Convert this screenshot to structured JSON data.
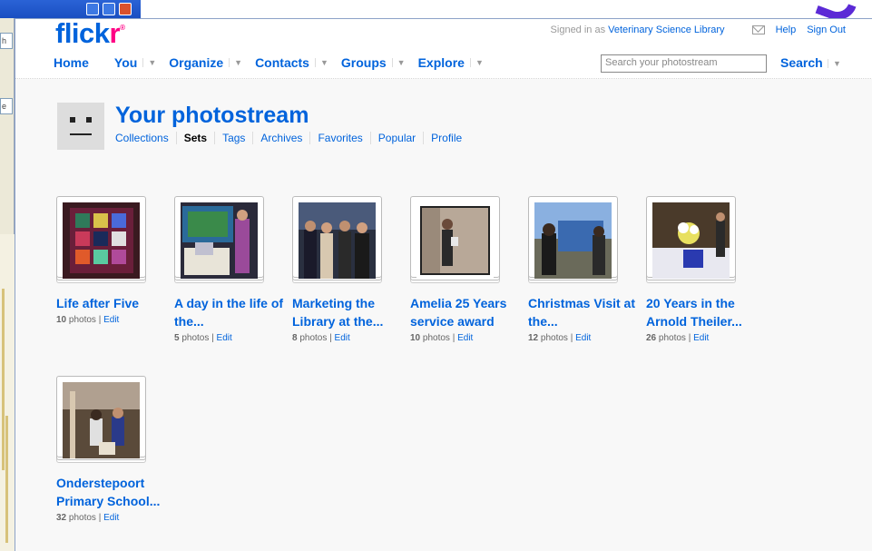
{
  "background": {
    "field1": "h",
    "field2": "e"
  },
  "header": {
    "logo_main": "flick",
    "logo_r": "r",
    "signed_in_prefix": "Signed in as",
    "signed_in_user": "Veterinary Science Library",
    "help": "Help",
    "sign_out": "Sign Out"
  },
  "nav": {
    "home": "Home",
    "you": "You",
    "organize": "Organize",
    "contacts": "Contacts",
    "groups": "Groups",
    "explore": "Explore",
    "dropdown_glyph": "▼"
  },
  "search": {
    "placeholder": "Search your photostream",
    "button": "Search"
  },
  "page": {
    "title": "Your photostream",
    "subnav": [
      "Collections",
      "Sets",
      "Tags",
      "Archives",
      "Favorites",
      "Popular",
      "Profile"
    ],
    "active_subnav": "Sets"
  },
  "sets": [
    {
      "title": "Life after Five",
      "count": "10",
      "unit": "photos",
      "edit": "Edit"
    },
    {
      "title": "A day in the life of the...",
      "count": "5",
      "unit": "photos",
      "edit": "Edit"
    },
    {
      "title": "Marketing the Library at the...",
      "count": "8",
      "unit": "photos",
      "edit": "Edit"
    },
    {
      "title": "Amelia 25 Years service award",
      "count": "10",
      "unit": "photos",
      "edit": "Edit"
    },
    {
      "title": "Christmas Visit at the...",
      "count": "12",
      "unit": "photos",
      "edit": "Edit"
    },
    {
      "title": "20 Years in the Arnold Theiler...",
      "count": "26",
      "unit": "photos",
      "edit": "Edit"
    },
    {
      "title": "Onderstepoort Primary School...",
      "count": "32",
      "unit": "photos",
      "edit": "Edit"
    }
  ],
  "colors": {
    "brand_blue": "#0063dc",
    "brand_pink": "#ff0084"
  }
}
